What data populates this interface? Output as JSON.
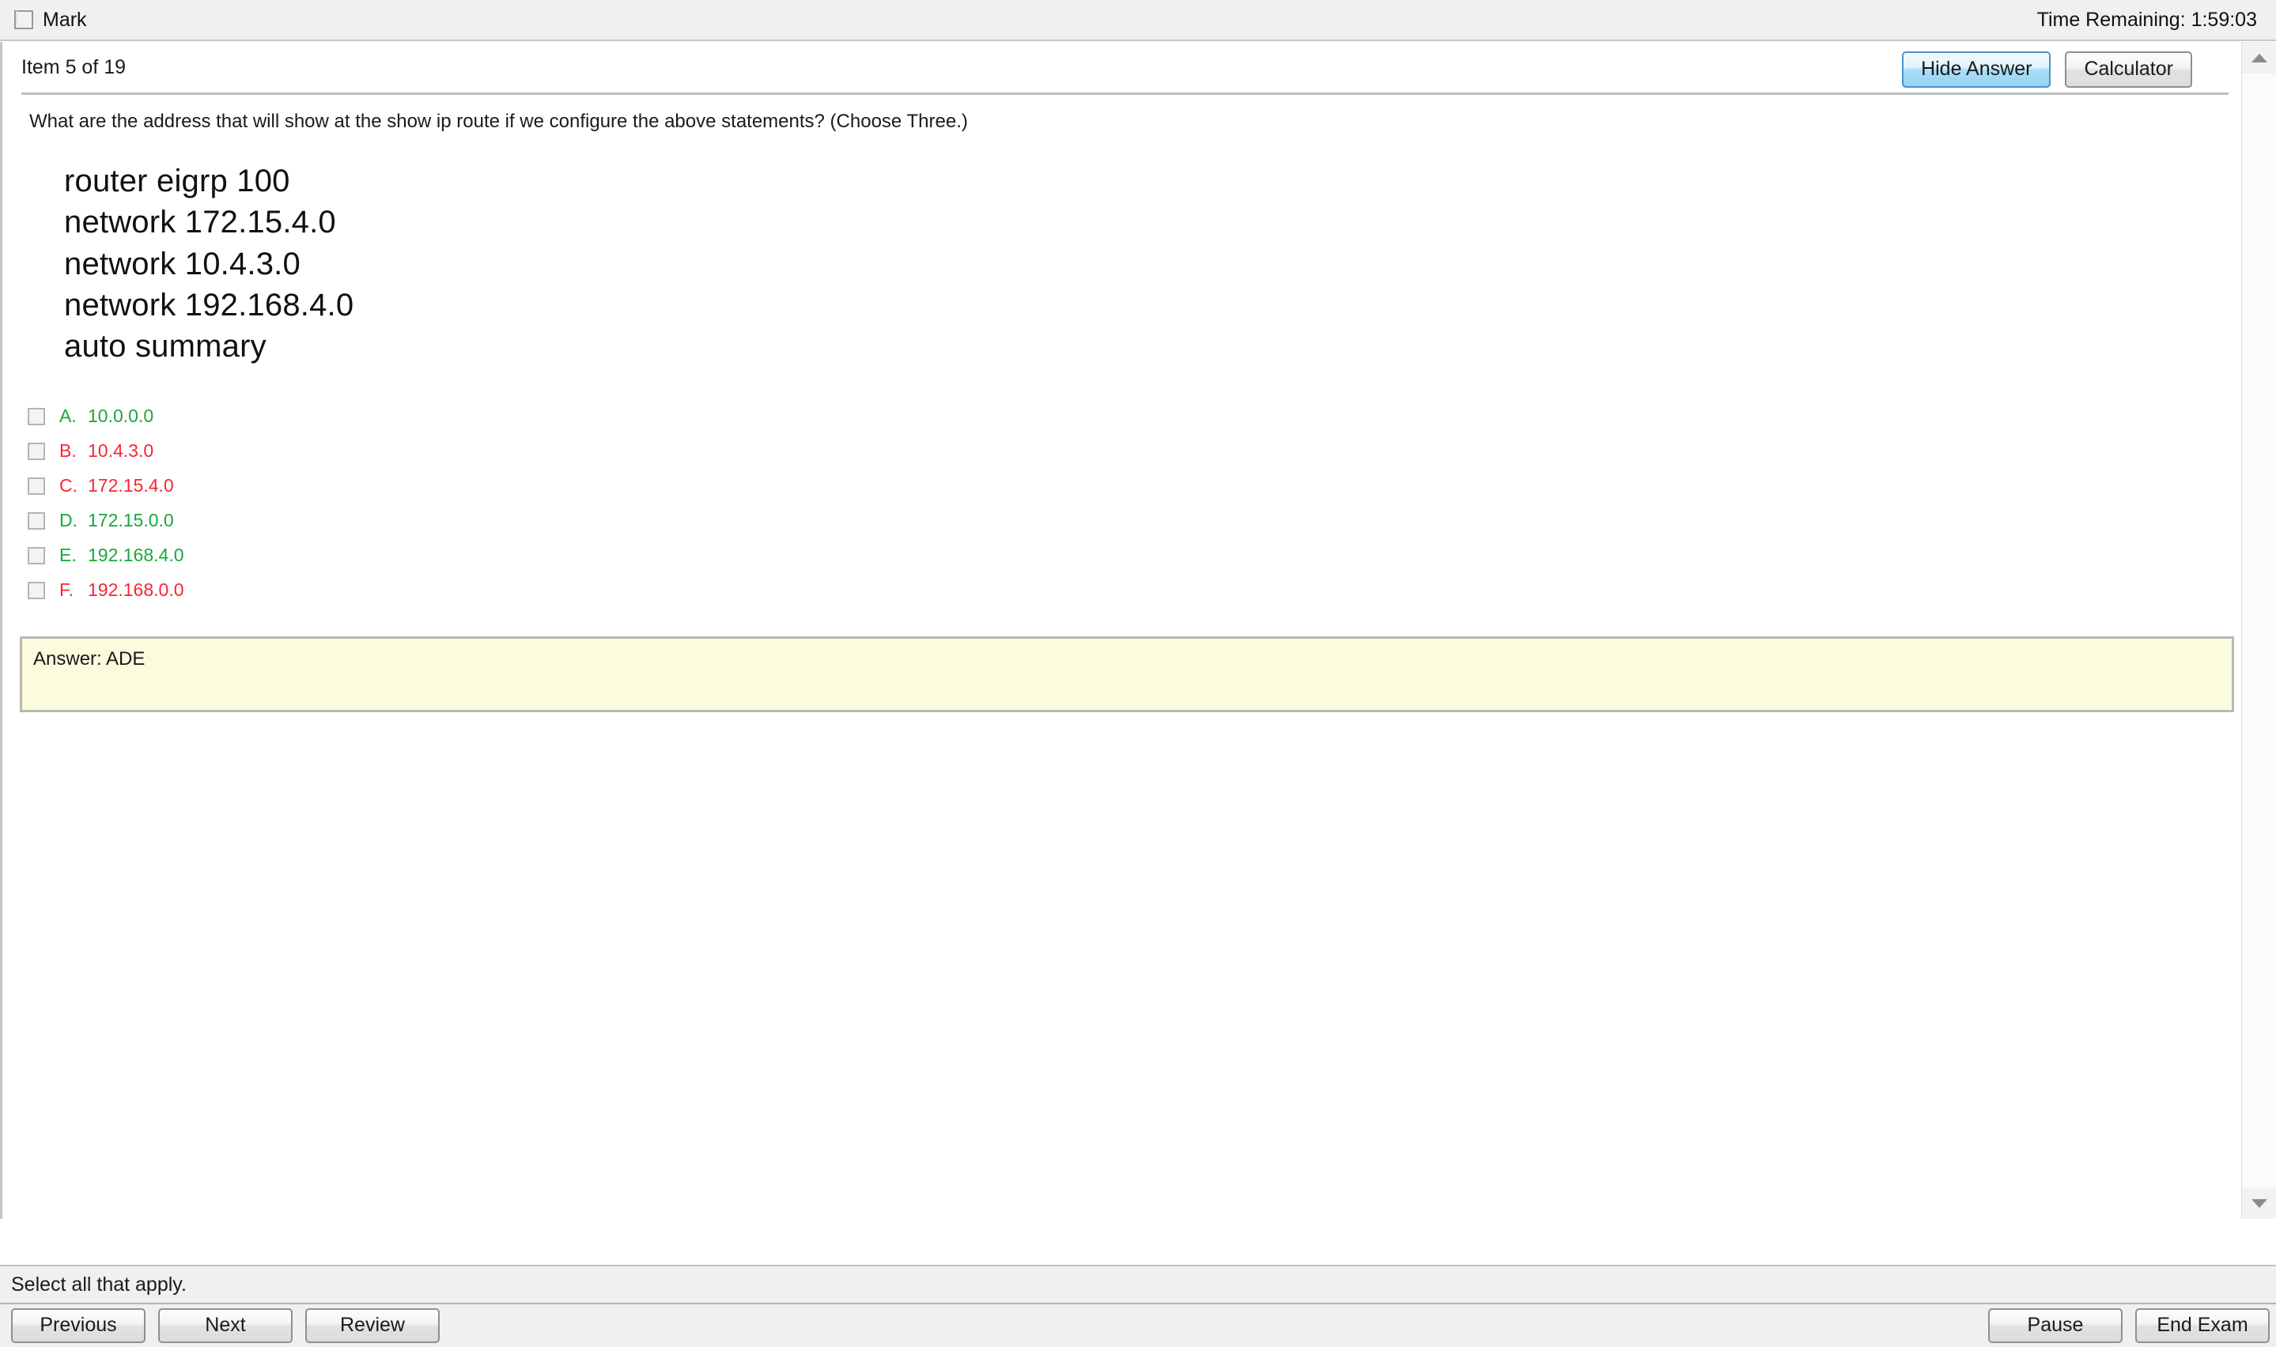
{
  "topbar": {
    "mark_label": "Mark",
    "mark_checked": false,
    "time_remaining": "Time Remaining: 1:59:03"
  },
  "header": {
    "item_count": "Item 5 of 19",
    "hide_answer_label": "Hide Answer",
    "calculator_label": "Calculator"
  },
  "question": {
    "text": "What are the address that will show at the show ip route if we configure the above statements? (Choose Three.)",
    "stimulus_lines": [
      "router eigrp 100",
      "network 172.15.4.0",
      "network 10.4.3.0",
      "network 192.168.4.0",
      "auto summary"
    ],
    "options": [
      {
        "letter": "A.",
        "text": "10.0.0.0",
        "color": "#18a83a",
        "checked": false
      },
      {
        "letter": "B.",
        "text": "10.4.3.0",
        "color": "#fb2436",
        "checked": false
      },
      {
        "letter": "C.",
        "text": "172.15.4.0",
        "color": "#fb2436",
        "checked": false
      },
      {
        "letter": "D.",
        "text": "172.15.0.0",
        "color": "#18a83a",
        "checked": false
      },
      {
        "letter": "E.",
        "text": "192.168.4.0",
        "color": "#18a83a",
        "checked": false
      },
      {
        "letter": "F.",
        "text": "192.168.0.0",
        "color": "#fb2436",
        "checked": false
      }
    ],
    "answer_text": "Answer: ADE"
  },
  "status": {
    "instruction": "Select all that apply."
  },
  "nav": {
    "previous_label": "Previous",
    "next_label": "Next",
    "review_label": "Review",
    "pause_label": "Pause",
    "end_exam_label": "End Exam"
  },
  "colors": {
    "correct": "#18a83a",
    "incorrect": "#fb2436",
    "answer_box_bg": "#fbfbdd",
    "primary_button": "#95d3f4",
    "chrome_bg": "#f0f0f0"
  }
}
